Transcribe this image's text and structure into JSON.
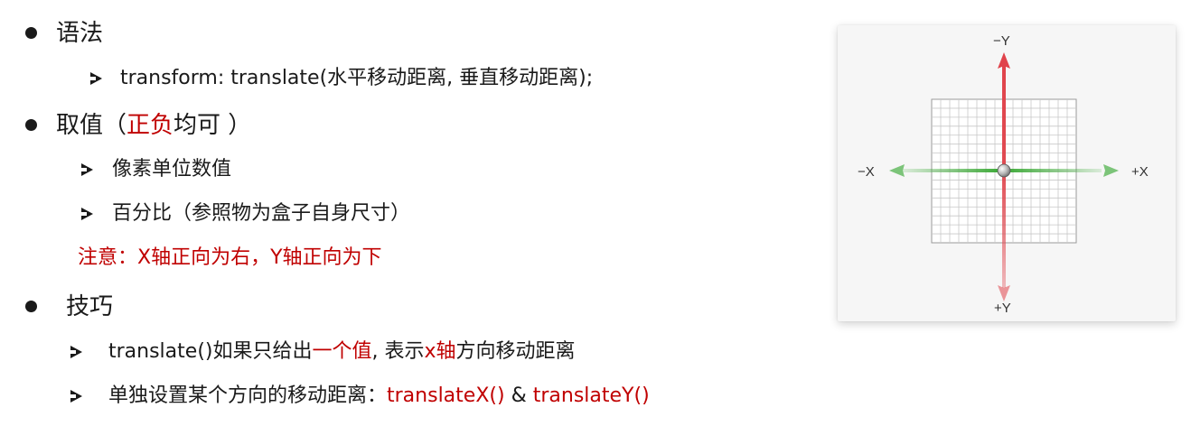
{
  "list": {
    "item1": {
      "label": "语法"
    },
    "item1_sub1": {
      "text": "transform: translate(水平移动距离, 垂直移动距离);"
    },
    "item2": {
      "label_a": "取值（",
      "label_red": "正负",
      "label_b": "均可 ）"
    },
    "item2_sub1": {
      "text": "像素单位数值"
    },
    "item2_sub2": {
      "text": "百分比（参照物为盒子自身尺寸）"
    },
    "note": {
      "text": "注意：X轴正向为右，Y轴正向为下"
    },
    "item3": {
      "label": "技巧"
    },
    "item3_sub1": {
      "a": "translate()如果只给出",
      "b": "一个值",
      "c": ", 表示",
      "d": "x轴",
      "e": "方向移动距离"
    },
    "item3_sub2": {
      "a": "单独设置某个方向的移动距离：",
      "b": "translateX()",
      "c": " & ",
      "d": "translateY()"
    }
  },
  "diagram": {
    "labels": {
      "neg_y": "−Y",
      "pos_y": "+Y",
      "neg_x": "−X",
      "pos_x": "+X"
    },
    "colors": {
      "x_axis": "#3aa935",
      "y_axis": "#e0434b",
      "grid": "#bfbfbf",
      "accent_text": "#c00000"
    }
  }
}
